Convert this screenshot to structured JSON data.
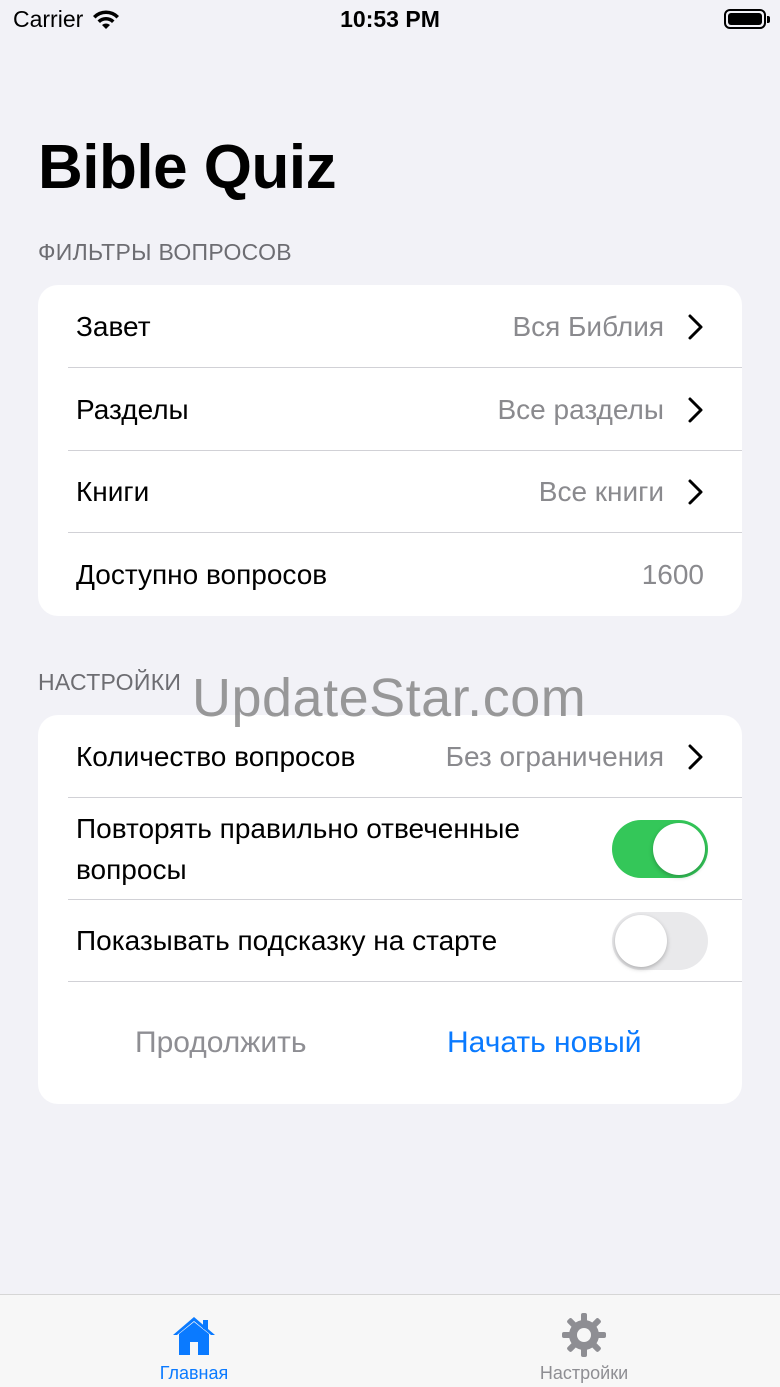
{
  "status_bar": {
    "carrier": "Carrier",
    "time": "10:53 PM"
  },
  "title": "Bible Quiz",
  "filters": {
    "header": "ФИЛЬТРЫ ВОПРОСОВ",
    "rows": [
      {
        "label": "Завет",
        "value": "Вся Библия"
      },
      {
        "label": "Разделы",
        "value": "Все разделы"
      },
      {
        "label": "Книги",
        "value": "Все книги"
      },
      {
        "label": "Доступно вопросов",
        "value": "1600"
      }
    ]
  },
  "settings": {
    "header": "НАСТРОЙКИ",
    "question_count": {
      "label": "Количество вопросов",
      "value": "Без ограничения"
    },
    "repeat_correct": {
      "label_line1": "Повторять правильно отвеченные",
      "label_line2": "вопросы",
      "enabled": true
    },
    "show_hint": {
      "label": "Показывать подсказку на старте",
      "enabled": false
    },
    "continue_label": "Продолжить",
    "start_new_label": "Начать новый"
  },
  "watermark": "UpdateStar.com",
  "tabbar": {
    "home_label": "Главная",
    "settings_label": "Настройки",
    "active": "home"
  },
  "colors": {
    "accent": "#0a7aff",
    "toggle_on": "#34c759",
    "background": "#f2f2f7",
    "secondary_text": "#8a8a8e"
  },
  "icons": {
    "wifi": "wifi-icon",
    "battery": "battery-icon",
    "chevron": "chevron-right-icon",
    "home": "house-icon",
    "settings": "gear-icon"
  }
}
